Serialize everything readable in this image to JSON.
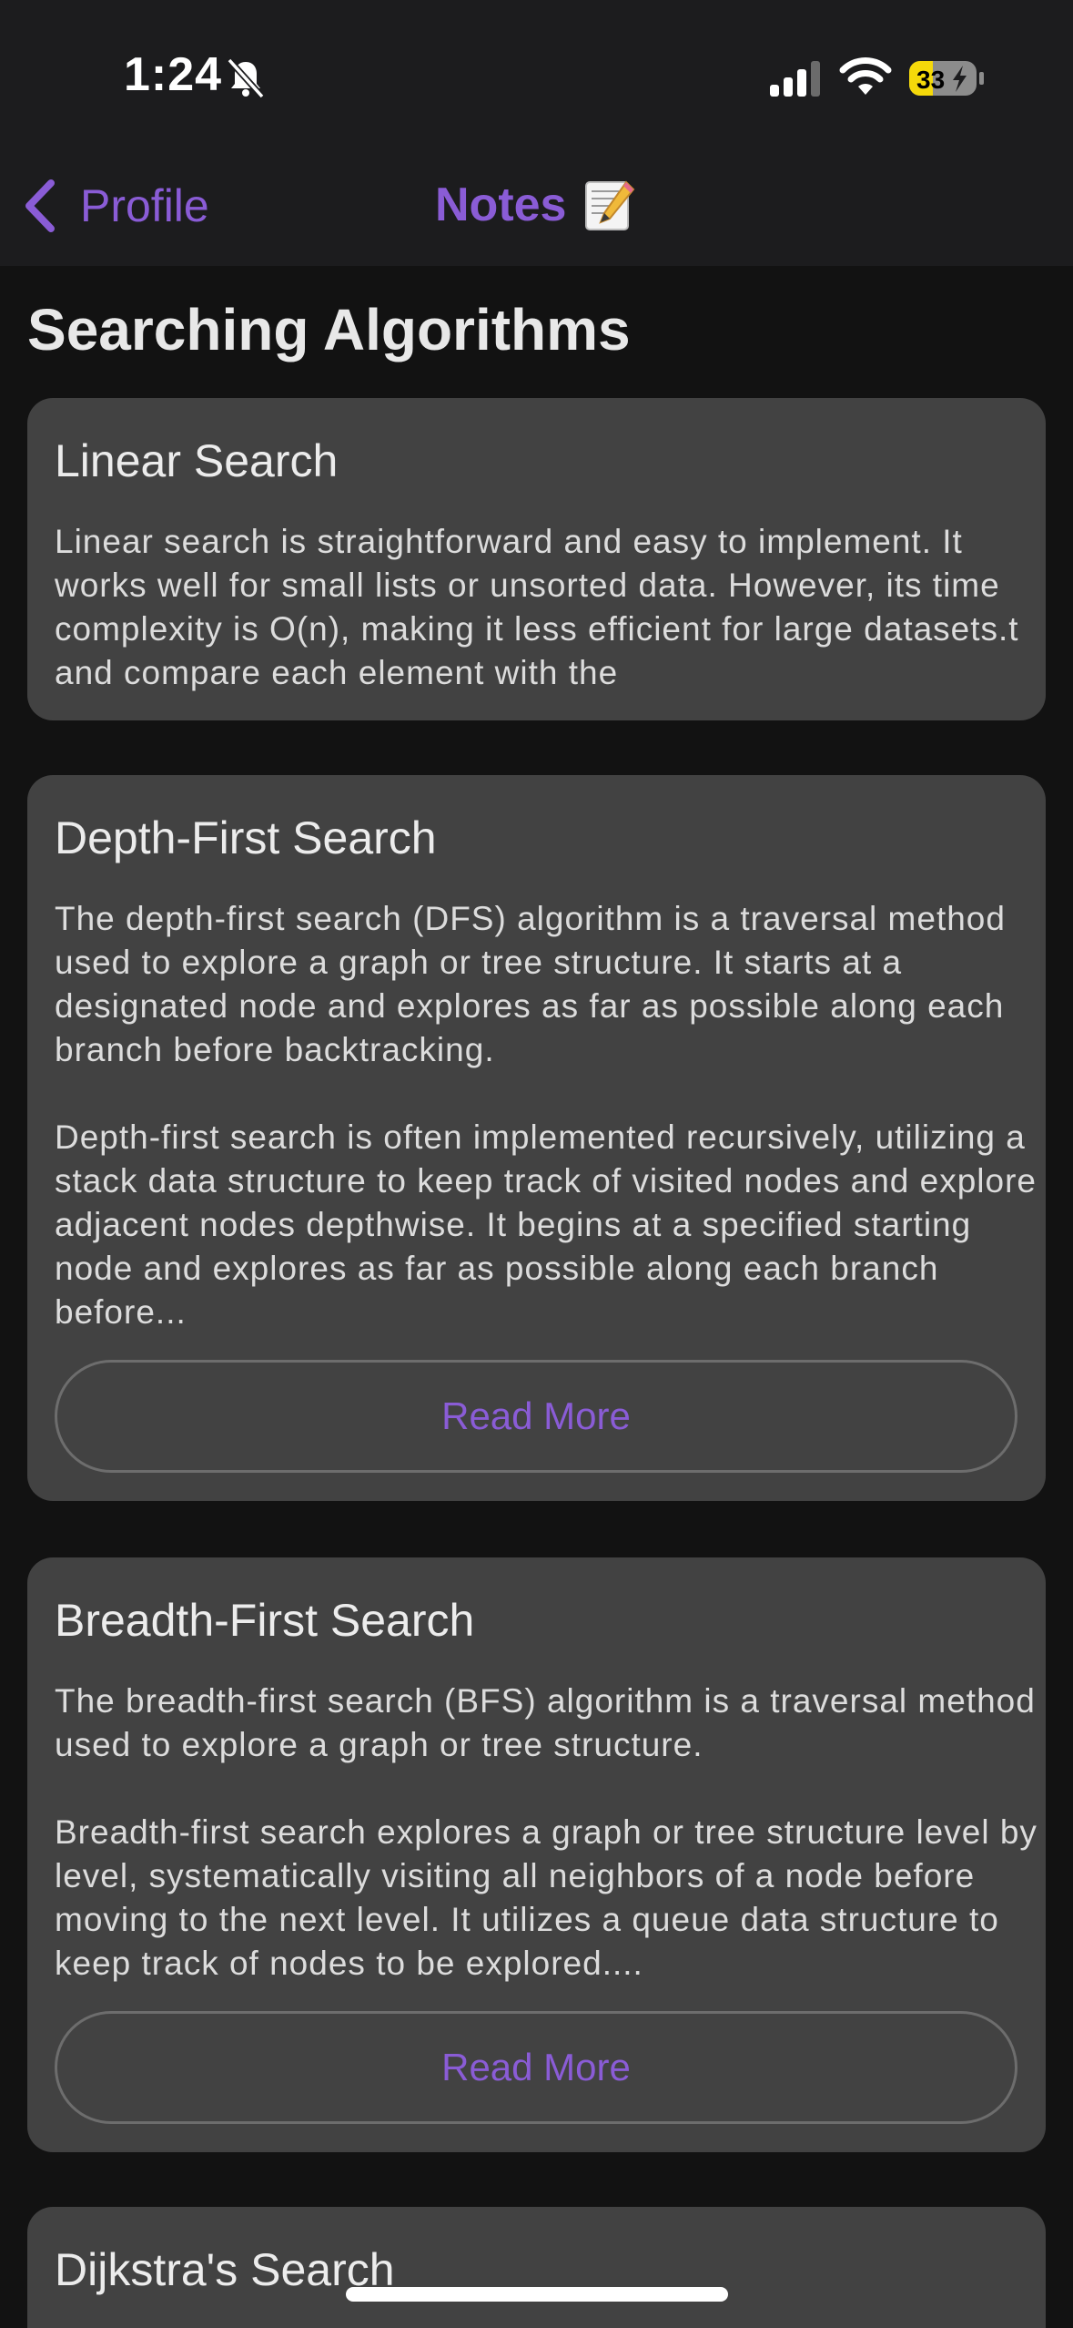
{
  "status_bar": {
    "time": "1:24",
    "battery_level": "33"
  },
  "nav": {
    "back_label": "Profile",
    "title": "Notes"
  },
  "section": {
    "title": "Searching Algorithms"
  },
  "cards": [
    {
      "title": "Linear Search",
      "body": "Linear search is straightforward and easy to implement. It works well for small lists or unsorted data. However, its time complexity is O(n), making it less efficient for large datasets.t and compare each element with the"
    },
    {
      "title": "Depth-First Search",
      "body": "The depth-first search (DFS) algorithm is a traversal method used to explore a graph or tree structure. It starts at a designated node and explores as far as possible along each branch before backtracking.\n\nDepth-first search is often implemented recursively, utilizing a stack data structure to keep track of visited nodes and explore adjacent nodes depthwise. It begins at a specified starting node and explores as far as possible along each branch before...",
      "button": "Read More"
    },
    {
      "title": "Breadth-First Search",
      "body": "The breadth-first search (BFS) algorithm is a traversal method used to explore a graph or tree structure.\n\nBreadth-first search explores a graph or tree structure level by level, systematically visiting all neighbors of a node before moving to the next level. It utilizes a queue data structure to keep track of nodes to be explored....",
      "button": "Read More"
    },
    {
      "title": "Dijkstra's Search"
    }
  ],
  "colors": {
    "accent": "#8a5cd6",
    "card_background": "#424242",
    "page_background": "#121212",
    "header_background": "#1c1c1e",
    "battery_fill": "#f5d90a"
  },
  "icons": {
    "mute": "bell-slash-icon",
    "signal": "cellular-signal-icon",
    "wifi": "wifi-icon",
    "battery": "battery-charging-icon",
    "back": "chevron-left-icon",
    "title_emoji": "memo-icon"
  }
}
